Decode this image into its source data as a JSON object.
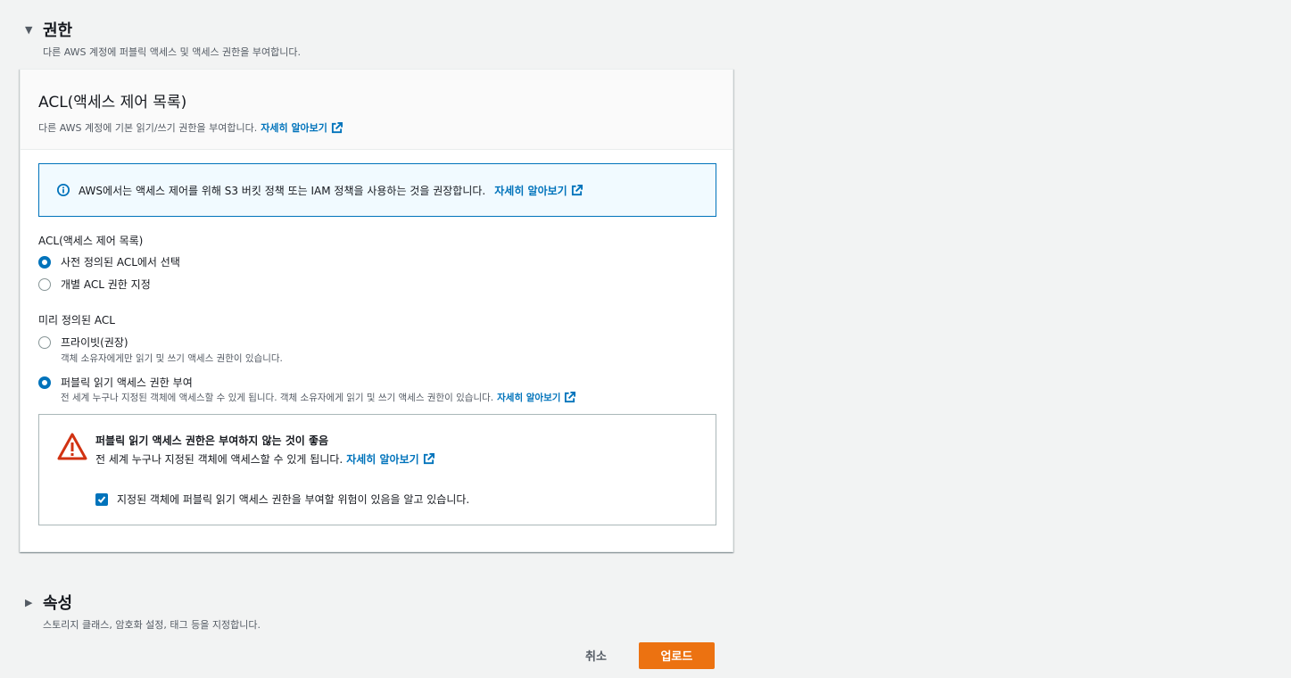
{
  "permissions": {
    "title": "권한",
    "description": "다른 AWS 계정에 퍼블릭 액세스 및 액세스 권한을 부여합니다."
  },
  "acl_panel": {
    "title": "ACL(액세스 제어 목록)",
    "description": "다른 AWS 계정에 기본 읽기/쓰기 권한을 부여합니다.",
    "learn_more": "자세히 알아보기"
  },
  "info": {
    "text": "AWS에서는 액세스 제어를 위해 S3 버킷 정책 또는 IAM 정책을 사용하는 것을 권장합니다.",
    "learn_more": "자세히 알아보기"
  },
  "acl_group": {
    "label": "ACL(액세스 제어 목록)",
    "options": [
      "사전 정의된 ACL에서 선택",
      "개별 ACL 권한 지정"
    ],
    "selected": 0
  },
  "predefined_group": {
    "label": "미리 정의된 ACL",
    "options": [
      {
        "label": "프라이빗(권장)",
        "description": "객체 소유자에게만 읽기 및 쓰기 액세스 권한이 있습니다."
      },
      {
        "label": "퍼블릭 읽기 액세스 권한 부여",
        "description": "전 세계 누구나 지정된 객체에 액세스할 수 있게 됩니다. 객체 소유자에게 읽기 및 쓰기 액세스 권한이 있습니다.",
        "learn_more": "자세히 알아보기"
      }
    ],
    "selected": 1
  },
  "warning": {
    "title": "퍼블릭 읽기 액세스 권한은 부여하지 않는 것이 좋음",
    "text": "전 세계 누구나 지정된 객체에 액세스할 수 있게 됩니다.",
    "learn_more": "자세히 알아보기",
    "acknowledge": "지정된 객체에 퍼블릭 읽기 액세스 권한을 부여할 위험이 있음을 알고 있습니다.",
    "acknowledged": true
  },
  "properties": {
    "title": "속성",
    "description": "스토리지 클래스, 암호화 설정, 태그 등을 지정합니다."
  },
  "footer": {
    "cancel": "취소",
    "upload": "업로드"
  },
  "colors": {
    "link": "#0073bb",
    "primary_button": "#ec7211",
    "warning": "#d13212"
  }
}
